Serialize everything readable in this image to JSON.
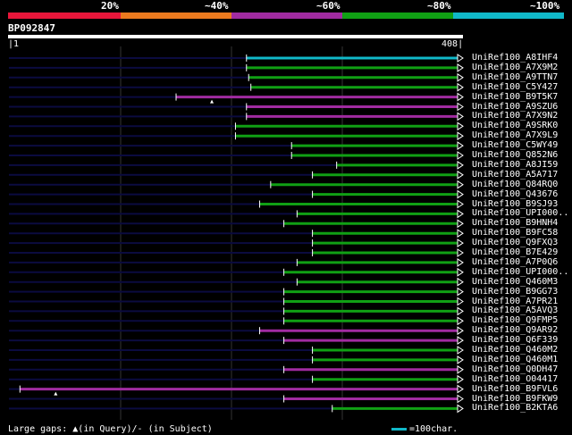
{
  "identity_scale": {
    "labels": [
      "20%",
      "~40%",
      "~60%",
      "~80%",
      "~100%"
    ],
    "colors": [
      "#e8163a",
      "#ec7a1e",
      "#a12ba1",
      "#10a014",
      "#10b8c8"
    ]
  },
  "query": {
    "id": "BP092847",
    "start": "1",
    "length": 408
  },
  "hits": [
    {
      "label": "UniRef100_A8IHF4",
      "start": 216,
      "color": "#10b8c8",
      "gaps": []
    },
    {
      "label": "UniRef100_A7X9M2",
      "start": 216,
      "color": "#10a014",
      "gaps": []
    },
    {
      "label": "UniRef100_A9TTN7",
      "start": 218,
      "color": "#10a014",
      "gaps": []
    },
    {
      "label": "UniRef100_C5Y427",
      "start": 220,
      "color": "#10a014",
      "gaps": []
    },
    {
      "label": "UniRef100_B9T5K7",
      "start": 152,
      "color": "#a12ba1",
      "gaps": [
        "query"
      ]
    },
    {
      "label": "UniRef100_A9SZU6",
      "start": 216,
      "color": "#a12ba1",
      "gaps": []
    },
    {
      "label": "UniRef100_A7X9N2",
      "start": 216,
      "color": "#a12ba1",
      "gaps": []
    },
    {
      "label": "UniRef100_A9SRK0",
      "start": 206,
      "color": "#10a014",
      "gaps": []
    },
    {
      "label": "UniRef100_A7X9L9",
      "start": 206,
      "color": "#10a014",
      "gaps": []
    },
    {
      "label": "UniRef100_C5WY49",
      "start": 257,
      "color": "#10a014",
      "gaps": []
    },
    {
      "label": "UniRef100_Q852N6",
      "start": 257,
      "color": "#10a014",
      "gaps": []
    },
    {
      "label": "UniRef100_A8JI59",
      "start": 298,
      "color": "#10a014",
      "gaps": []
    },
    {
      "label": "UniRef100_A5A717",
      "start": 276,
      "color": "#10a014",
      "gaps": []
    },
    {
      "label": "UniRef100_Q84RQ0",
      "start": 238,
      "color": "#10a014",
      "gaps": []
    },
    {
      "label": "UniRef100_Q43676",
      "start": 276,
      "color": "#10a014",
      "gaps": []
    },
    {
      "label": "UniRef100_B9SJ93",
      "start": 228,
      "color": "#10a014",
      "gaps": []
    },
    {
      "label": "UniRef100_UPI000..",
      "start": 262,
      "color": "#10a014",
      "gaps": []
    },
    {
      "label": "UniRef100_B9HNH4",
      "start": 250,
      "color": "#10a014",
      "gaps": []
    },
    {
      "label": "UniRef100_B9FC58",
      "start": 276,
      "color": "#10a014",
      "gaps": []
    },
    {
      "label": "UniRef100_Q9FXQ3",
      "start": 276,
      "color": "#10a014",
      "gaps": []
    },
    {
      "label": "UniRef100_B7E429",
      "start": 276,
      "color": "#10a014",
      "gaps": []
    },
    {
      "label": "UniRef100_A7P0Q6",
      "start": 262,
      "color": "#10a014",
      "gaps": []
    },
    {
      "label": "UniRef100_UPI000..",
      "start": 250,
      "color": "#10a014",
      "gaps": []
    },
    {
      "label": "UniRef100_Q460M3",
      "start": 262,
      "color": "#10a014",
      "gaps": []
    },
    {
      "label": "UniRef100_B9GG73",
      "start": 250,
      "color": "#10a014",
      "gaps": []
    },
    {
      "label": "UniRef100_A7PR21",
      "start": 250,
      "color": "#10a014",
      "gaps": []
    },
    {
      "label": "UniRef100_A5AVQ3",
      "start": 250,
      "color": "#10a014",
      "gaps": []
    },
    {
      "label": "UniRef100_Q9FMP5",
      "start": 250,
      "color": "#10a014",
      "gaps": []
    },
    {
      "label": "UniRef100_Q9AR92",
      "start": 228,
      "color": "#a12ba1",
      "gaps": []
    },
    {
      "label": "UniRef100_Q6F339",
      "start": 250,
      "color": "#a12ba1",
      "gaps": []
    },
    {
      "label": "UniRef100_Q460M2",
      "start": 276,
      "color": "#10a014",
      "gaps": []
    },
    {
      "label": "UniRef100_Q460M1",
      "start": 276,
      "color": "#10a014",
      "gaps": []
    },
    {
      "label": "UniRef100_Q0DH47",
      "start": 250,
      "color": "#a12ba1",
      "gaps": []
    },
    {
      "label": "UniRef100_O04417",
      "start": 276,
      "color": "#10a014",
      "gaps": []
    },
    {
      "label": "UniRef100_B9FVL6",
      "start": 10,
      "color": "#a12ba1",
      "gaps": [
        "query"
      ]
    },
    {
      "label": "UniRef100_B9FKW9",
      "start": 250,
      "color": "#a12ba1",
      "gaps": []
    },
    {
      "label": "UniRef100_B2KTA6",
      "start": 294,
      "color": "#10a014",
      "gaps": []
    }
  ],
  "legend": {
    "gaps_label": "Large gaps:",
    "in_query_label": "(in Query)/",
    "in_subject_label": "- (in Subject)",
    "scale_label": "=100char."
  }
}
